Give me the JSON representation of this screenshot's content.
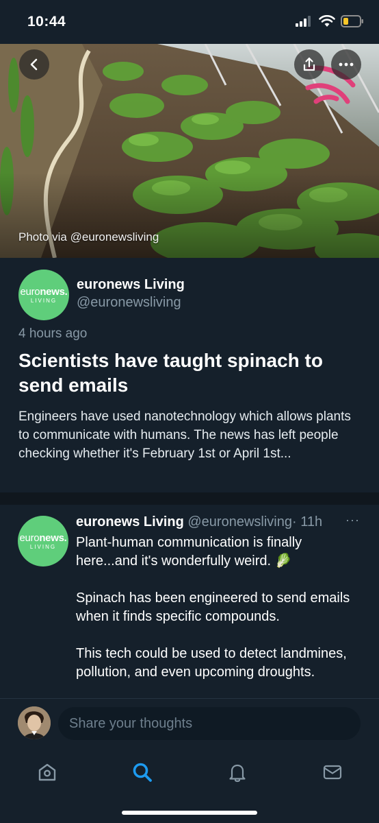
{
  "status": {
    "time": "10:44"
  },
  "hero": {
    "caption": "Photo via @euronewsliving",
    "icons": [
      "back-icon",
      "share-icon",
      "more-icon"
    ]
  },
  "article": {
    "avatar": {
      "line1_a": "euro",
      "line1_b": "news.",
      "line2": "LIVING"
    },
    "author_name": "euronews Living",
    "author_handle": "@euronewsliving",
    "timestamp": "4 hours ago",
    "headline": "Scientists have taught spinach to send emails",
    "summary": "Engineers have used nanotechnology which allows plants to communicate with humans. The news has left people checking whether it's February 1st or April 1st..."
  },
  "tweet": {
    "name": "euronews Living",
    "handle": "@euronewsliving",
    "time": "· 11h",
    "more": "···",
    "text": "Plant-human communication is finally here...and it's wonderfully weird. 🥬\n\nSpinach has been engineered to send emails when it finds specific compounds.\n\nThis tech could be used to detect landmines, pollution, and even upcoming droughts."
  },
  "composer": {
    "placeholder": "Share your thoughts"
  },
  "tabs": [
    {
      "name": "home",
      "icon": "home-icon",
      "active": false
    },
    {
      "name": "search",
      "icon": "search-icon",
      "active": true
    },
    {
      "name": "notifications",
      "icon": "bell-icon",
      "active": false
    },
    {
      "name": "messages",
      "icon": "mail-icon",
      "active": false
    }
  ],
  "colors": {
    "background": "#15202b",
    "accent": "#1d9bf0",
    "secondary_text": "#8899a6",
    "euronews_green": "#5fce7b",
    "live_pink": "#e0407a"
  }
}
